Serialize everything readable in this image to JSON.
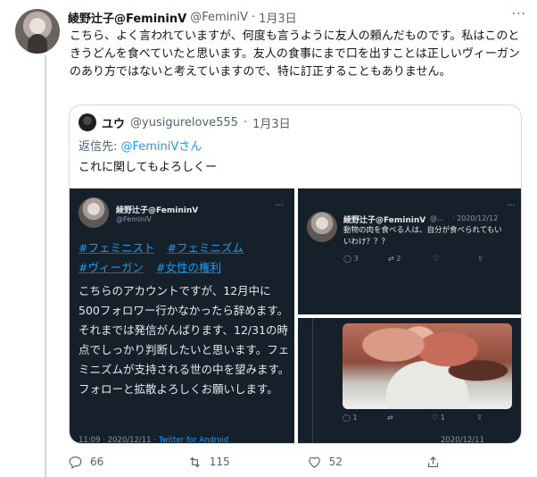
{
  "tweet": {
    "display_name": "綾野辻子@FemininV",
    "handle": "@FeminiV",
    "separator": "·",
    "date": "1月3日",
    "more": "···",
    "text": "こちら、よく言われていますが、何度も言うように友人の頼んだものです。私はこのときうどんを食べていたと思います。友人の食事にまで口を出すことは正しいヴィーガンのあり方ではないと考えていますので、特に訂正することもありません。"
  },
  "quote": {
    "display_name": "ユウ",
    "handle": "@yusigurelove555",
    "separator": "·",
    "date": "1月3日",
    "reply_prefix": "返信先: ",
    "reply_handle": "@FeminiVさん",
    "text": "これに関してもよろしくー"
  },
  "media_left": {
    "display_name": "綾野辻子@FemininV",
    "handle": "@FeminiV",
    "more": "···",
    "hashtags": [
      "#フェミニスト",
      "#フェミニズム",
      "#ヴィーガン",
      "#女性の権利"
    ],
    "body": "こちらのアカウントですが、12月中に500フォロワー行かなかったら辞めます。それまでは発信がんばります、12/31の時点でしっかり判断したいと思います。フェミニズムが支持される世の中を望みます。フォローと拡散よろしくお願いします。",
    "footer_time": "11:09 · 2020/12/11 · ",
    "footer_source": "Twitter for Android"
  },
  "media_top_right": {
    "display_name": "綾野辻子@FemininV",
    "handle": "@...",
    "date": "· 2020/12/12",
    "more": "···",
    "text": "動物の肉を食べる人は、自分が食べられてもいいわけ？？？",
    "reply_count": "3",
    "retweet_count": "2",
    "like_count": "",
    "share": ""
  },
  "media_bottom_right": {
    "reply_count": "1",
    "retweet_count": "",
    "like_count": "1",
    "footer_date": "2020/12/11"
  },
  "actions": {
    "reply_count": "66",
    "retweet_count": "115",
    "like_count": "52"
  },
  "colors": {
    "accent": "#1d9bf0",
    "dark_panel": "#15202b",
    "secondary_text": "#536471"
  }
}
